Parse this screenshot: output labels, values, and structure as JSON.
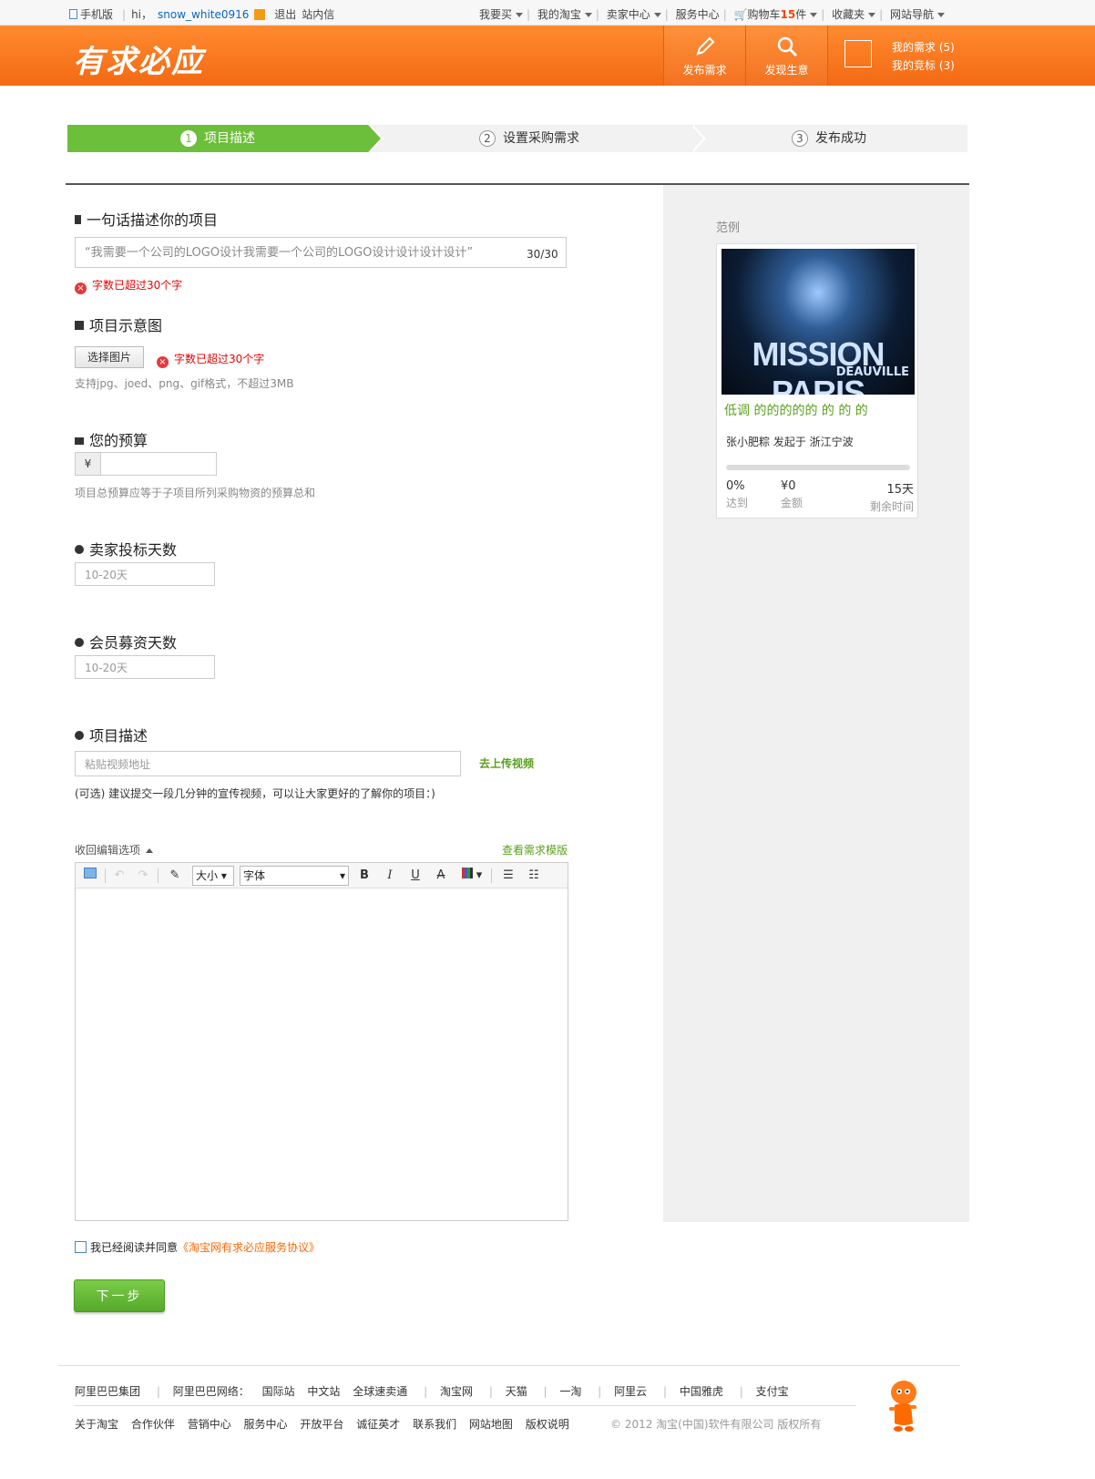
{
  "topbar": {
    "mobile": "手机版",
    "hi": "hi，",
    "username": "snow_white0916",
    "logout": "退出",
    "messages": "站内信",
    "menu": [
      "我要买",
      "我的淘宝",
      "卖家中心",
      "服务中心"
    ],
    "cart_label": "购物车",
    "cart_count": "15",
    "cart_unit": "件",
    "favorites": "收藏夹",
    "site_nav": "网站导航"
  },
  "header": {
    "logo": "有求必应",
    "post_label": "发布需求",
    "find_label": "发现生意",
    "my_needs": "我的需求 (5)",
    "my_bids": "我的竞标 (3)"
  },
  "steps": [
    {
      "num": "1",
      "label": "项目描述"
    },
    {
      "num": "2",
      "label": "设置采购需求"
    },
    {
      "num": "3",
      "label": "发布成功"
    }
  ],
  "form": {
    "desc_title": "一句话描述你的项目",
    "desc_value": "“我需要一个公司的LOGO设计我需要一个公司的LOGO设计设计设计设计”",
    "desc_count": "30/30",
    "desc_error": "字数已超过30个字",
    "img_title": "项目示意图",
    "choose_btn": "选择图片",
    "img_error": "字数已超过30个字",
    "img_hint": "支持jpg、joed、png、gif格式，不超过3MB",
    "budget_title": "您的预算",
    "yen": "¥",
    "budget_hint": "项目总预算应等于子项目所列采购物资的预算总和",
    "bid_days_title": "卖家投标天数",
    "bid_days_placeholder": "10-20天",
    "fund_days_title": "会员募资天数",
    "fund_days_placeholder": "10-20天",
    "proj_title": "项目描述",
    "video_placeholder": "粘贴视频地址",
    "upload_video": "去上传视频",
    "video_hint": "(可选) 建议提交一段几分钟的宣传视频，可以让大家更好的了解你的项目：)",
    "collapse": "收回编辑选项",
    "template_link": "查看需求模版",
    "agree_prefix": "我已经阅读并同意",
    "agree_link": "《淘宝网有求必应服务协议》",
    "next": "下一步"
  },
  "editor": {
    "size": "大小",
    "font": "字体",
    "bold": "B",
    "italic": "I",
    "underline": "U",
    "strike": "A"
  },
  "example": {
    "title": "范例",
    "image_text": "MISSION PARIS",
    "image_sub": "DEAUVILLE",
    "card_title": "低调 的的的的的 的 的 的",
    "author": "张小肥粽 发起于 浙江宁波",
    "progress": 0,
    "stat1_value": "0%",
    "stat1_label": "达到",
    "stat2_value": "¥0",
    "stat2_label": "金额",
    "stat3_value": "15天",
    "stat3_label": "剩余时间"
  },
  "footer": {
    "row1": [
      "阿里巴巴集团",
      "|",
      "阿里巴巴网络：",
      "国际站",
      "中文站",
      "全球速卖通",
      "|",
      "淘宝网",
      "|",
      "天猫",
      "|",
      "一淘",
      "|",
      "阿里云",
      "|",
      "中国雅虎",
      "|",
      "支付宝"
    ],
    "row2": [
      "关于淘宝",
      "合作伙伴",
      "营销中心",
      "服务中心",
      "开放平台",
      "诚征英才",
      "联系我们",
      "网站地图",
      "版权说明"
    ],
    "copyright": "© 2012 淘宝(中国)软件有限公司 版权所有"
  }
}
